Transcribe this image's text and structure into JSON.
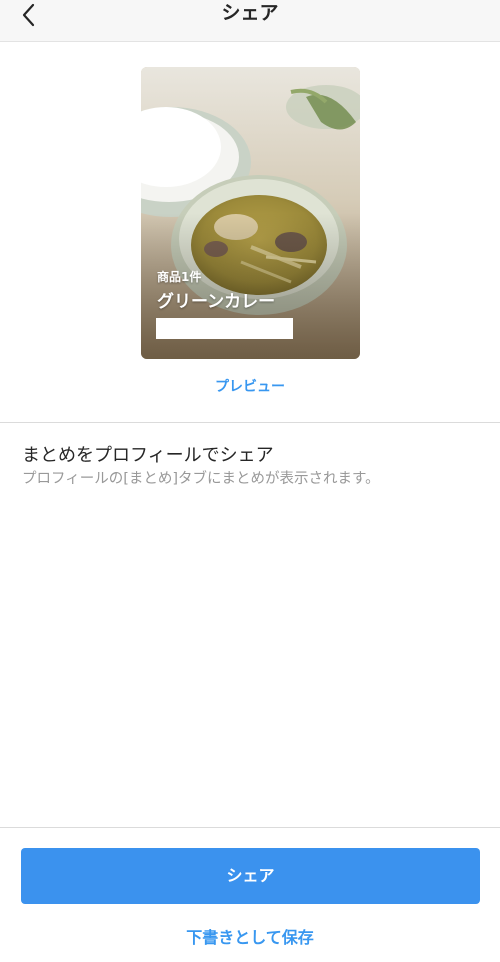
{
  "header": {
    "title": "シェア",
    "back_icon": "chevron-left-icon"
  },
  "preview_card": {
    "count_label": "商品1件",
    "title": "グリーンカレー",
    "image": "green-curry-photo"
  },
  "preview_link": "プレビュー",
  "profile_share": {
    "title": "まとめをプロフィールでシェア",
    "description": "プロフィールの[まとめ]タブにまとめが表示されます。"
  },
  "actions": {
    "share_label": "シェア",
    "save_draft_label": "下書きとして保存"
  },
  "colors": {
    "accent": "#3897f0",
    "button": "#3b92ee"
  }
}
